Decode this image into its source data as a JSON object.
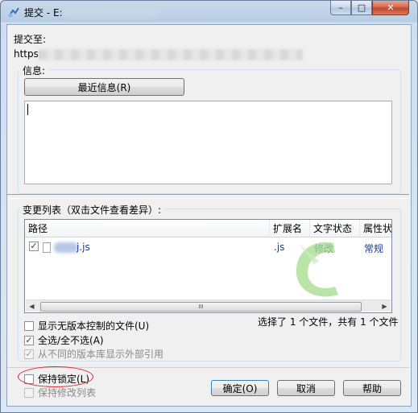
{
  "window": {
    "title": "提交 - E:",
    "minimize_glyph": "–",
    "maximize_glyph": "□",
    "close_glyph": "✕"
  },
  "submit_to": {
    "label": "提交至:",
    "url_prefix": "https:"
  },
  "message": {
    "group_label": "信息:",
    "recent_button": "最近信息(R)",
    "text": ""
  },
  "changes": {
    "group_label": "变更列表（双击文件查看差异）:",
    "columns": [
      "路径",
      "扩展名",
      "文字状态",
      "属性状"
    ],
    "rows": [
      {
        "checked": true,
        "path": "j.js",
        "ext": ".js",
        "status": "修改",
        "prop_status": "常规"
      }
    ],
    "scroll_grip": "III",
    "scroll_left_glyph": "◀",
    "scroll_right_glyph": "▶",
    "selection_summary": "选择了 1 个文件，共有 1 个文件"
  },
  "options": {
    "show_unversioned": "显示无版本控制的文件(U)",
    "select_all": "全选/全不选(A)",
    "show_externals": "从不同的版本库显示外部引用",
    "keep_locks": "保持锁定(L)",
    "keep_changelists": "保持修改列表"
  },
  "buttons": {
    "ok": "确定(O)",
    "cancel": "取消",
    "help": "帮助"
  },
  "colors": {
    "highlight_ellipse": "#e0282c",
    "link_text": "#1b3a8f",
    "watermark": "#8fd17a"
  }
}
